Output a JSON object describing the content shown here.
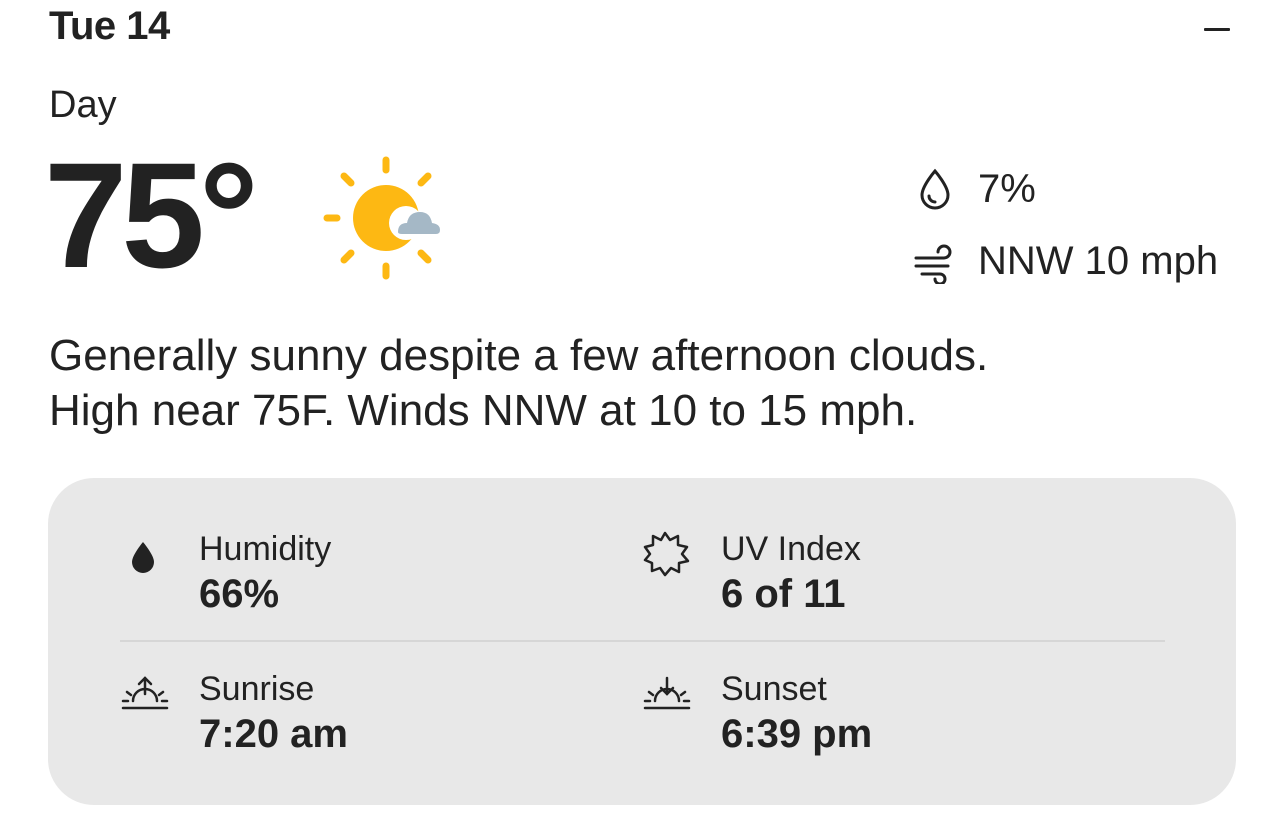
{
  "header": {
    "day": "Tue 14",
    "period": "Day",
    "collapse_icon": "minus-icon"
  },
  "current": {
    "temperature": "75°",
    "condition_icon": "partly-sunny-icon",
    "precipitation": "7%",
    "precipitation_icon": "raindrop-outline-icon",
    "wind": "NNW 10 mph",
    "wind_icon": "wind-icon"
  },
  "summary": {
    "line1": "Generally sunny despite a few afternoon clouds.",
    "line2": "High near 75F. Winds NNW at 10 to 15 mph."
  },
  "details": {
    "humidity": {
      "label": "Humidity",
      "value": "66%",
      "icon": "humidity-drop-icon"
    },
    "uv_index": {
      "label": "UV Index",
      "value": "6 of 11",
      "icon": "uv-sun-icon"
    },
    "sunrise": {
      "label": "Sunrise",
      "value": "7:20 am",
      "icon": "sunrise-icon"
    },
    "sunset": {
      "label": "Sunset",
      "value": "6:39 pm",
      "icon": "sunset-icon"
    }
  },
  "colors": {
    "sun": "#FDB813",
    "cloud": "#A5B8C6",
    "text": "#222222",
    "panel": "#E8E8E8"
  }
}
